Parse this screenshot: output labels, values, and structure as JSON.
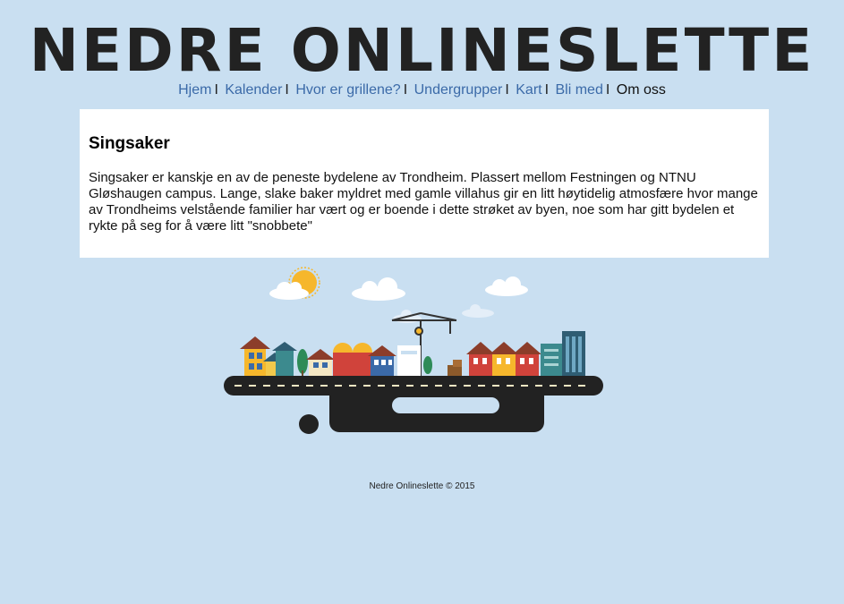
{
  "site": {
    "title": "NEDRE ONLINESLETTE"
  },
  "nav": {
    "items": [
      {
        "label": "Hjem",
        "current": false
      },
      {
        "label": "Kalender",
        "current": false
      },
      {
        "label": "Hvor er grillene?",
        "current": false
      },
      {
        "label": "Undergrupper",
        "current": false
      },
      {
        "label": "Kart",
        "current": false
      },
      {
        "label": "Bli med",
        "current": false
      },
      {
        "label": "Om oss",
        "current": true
      }
    ],
    "separator": "I",
    "link_color": "#3b6aa8"
  },
  "main": {
    "heading": "Singsaker",
    "body": "Singsaker er kanskje en av de peneste bydelene av Trondheim. Plassert mellom Festningen og NTNU Gløshaugen campus. Lange, slake baker myldret med gamle villahus gir en litt høytidelig atmosfære hvor mange av Trondheims velstående familier har vært og er boende i dette strøket av byen, noe som har gitt bydelen et rykte på seg for å være litt \"snobbete\""
  },
  "illustration": {
    "name": "city-illustration"
  },
  "footer": {
    "text": "Nedre Onlineslette © 2015"
  },
  "colors": {
    "background": "#c9dff1",
    "panel": "#ffffff"
  }
}
